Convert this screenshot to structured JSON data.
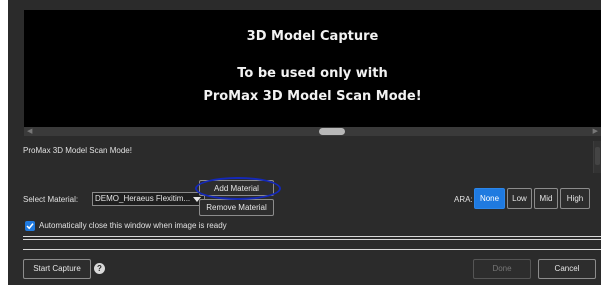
{
  "preview": {
    "title": "3D Model Capture",
    "line1": "To be used only with",
    "line2": "ProMax 3D Model Scan Mode!"
  },
  "status": {
    "text": "ProMax 3D Model Scan Mode!"
  },
  "material": {
    "label": "Select Material:",
    "selected": "DEMO_Heraeus Flexitim...",
    "add_label": "Add Material",
    "remove_label": "Remove Material"
  },
  "ara": {
    "label": "ARA:",
    "options": [
      "None",
      "Low",
      "Mid",
      "High"
    ],
    "selected": "None"
  },
  "auto_close": {
    "label": "Automatically close this window when image is ready",
    "checked": true
  },
  "footer": {
    "start_label": "Start Capture",
    "help_glyph": "?",
    "done_label": "Done",
    "cancel_label": "Cancel"
  },
  "colors": {
    "accent": "#1f7ae0",
    "highlight": "#1428b8",
    "background": "#2b2b2b"
  }
}
